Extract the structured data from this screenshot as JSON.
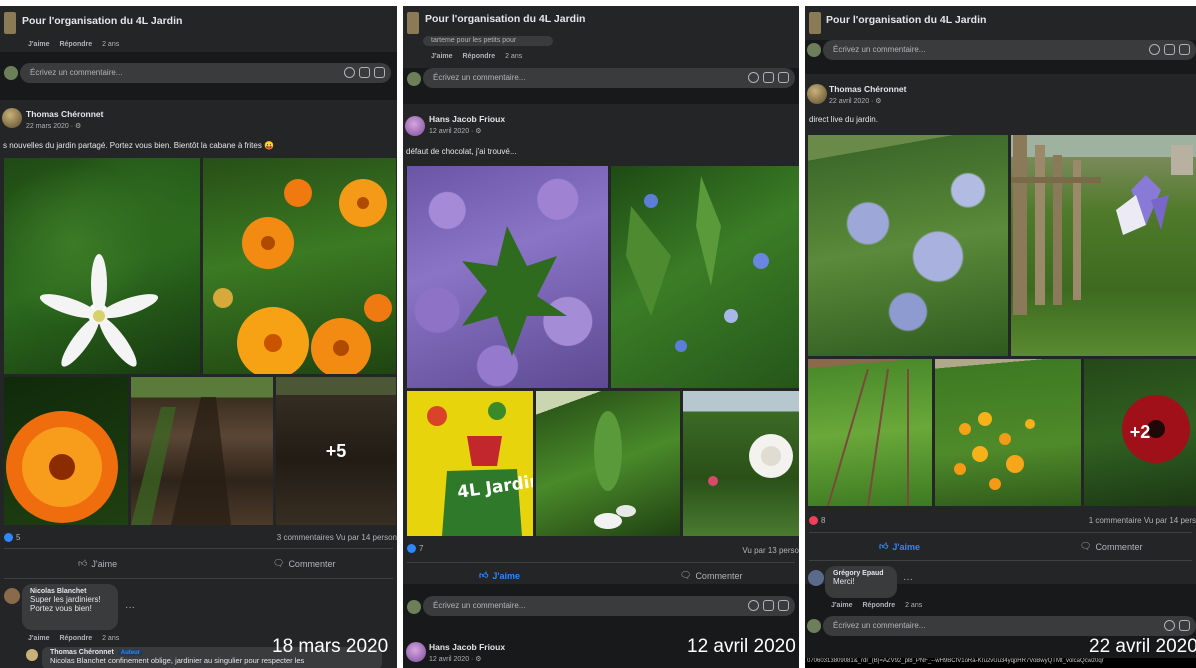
{
  "colors": {
    "background": "#18191a",
    "card": "#242526",
    "accent": "#2d88ff",
    "text": "#e4e6eb",
    "muted": "#b0b3b8"
  },
  "panels": [
    {
      "group_title": "Pour l'organisation du 4L Jardin",
      "top_actions": {
        "like": "J'aime",
        "reply": "Répondre",
        "time": "2 ans"
      },
      "comment_placeholder": "Écrivez un commentaire...",
      "post": {
        "author": "Thomas Chéronnet",
        "date": "22 mars 2020 · ⚙",
        "text": "s nouvelles du jardin partagé. Portez vous bien. Bientôt la cabane à frites 😛",
        "more_photos": "+5",
        "reactions": "5",
        "stats_right": "3 commentaires  Vu par 14 person"
      },
      "buttons": {
        "like": "J'aime",
        "comment": "Commenter"
      },
      "comments": [
        {
          "author": "Nicolas Blanchet",
          "line1": "Super les jardiniers!",
          "line2": "Portez vous bien!",
          "like": "J'aime",
          "reply": "Répondre",
          "time": "2 ans"
        }
      ],
      "reply": {
        "author": "Thomas Chéronnet",
        "badge": "Auteur",
        "text": "Nicolas Blanchet confinement oblige, jardinier au singulier pour respecter les"
      },
      "date_label": "18 mars 2020"
    },
    {
      "group_title": "Pour l'organisation du 4L Jardin",
      "partial_text": "tarteme pour les petits pour",
      "top_actions": {
        "like": "J'aime",
        "reply": "Répondre",
        "time": "2 ans"
      },
      "comment_placeholder": "Écrivez un commentaire...",
      "post": {
        "author": "Hans Jacob Frioux",
        "date": "12 avril 2020 · ⚙",
        "text": "défaut de chocolat, j'ai trouvé...",
        "poster_text": "4L Jardin",
        "reactions": "7",
        "stats_right": "Vu par 13 perso"
      },
      "buttons": {
        "like": "J'aime",
        "comment": "Commenter"
      },
      "comment_placeholder_2": "Écrivez un commentaire...",
      "next_post": {
        "author": "Hans Jacob Frioux",
        "date": "12 avril 2020 · ⚙"
      },
      "date_label": "12 avril 2020"
    },
    {
      "group_title": "Pour l'organisation du 4L Jardin",
      "comment_placeholder": "Écrivez un commentaire...",
      "post": {
        "author": "Thomas Chéronnet",
        "date": "22 avril 2020 · ⚙",
        "text": "direct live du jardin.",
        "more_photos": "+2",
        "reactions": "8",
        "stats_right": "1 commentaire  Vu par 14 pers"
      },
      "buttons": {
        "like": "J'aime",
        "comment": "Commenter"
      },
      "comments": [
        {
          "author": "Grégory Epaud",
          "line1": "Merci!",
          "like": "J'aime",
          "reply": "Répondre",
          "time": "2 ans"
        }
      ],
      "comment_placeholder_2": "Écrivez un commentaire...",
      "url_text": "07060313809081&_rdr_(B]=AZV92_pl8_PNF_--wH9BCIV1oRa-Kru2vUu34yqpHR7VoBwyQTMt_volcaQcwz0qr",
      "date_label": "22 avril 2020"
    }
  ]
}
